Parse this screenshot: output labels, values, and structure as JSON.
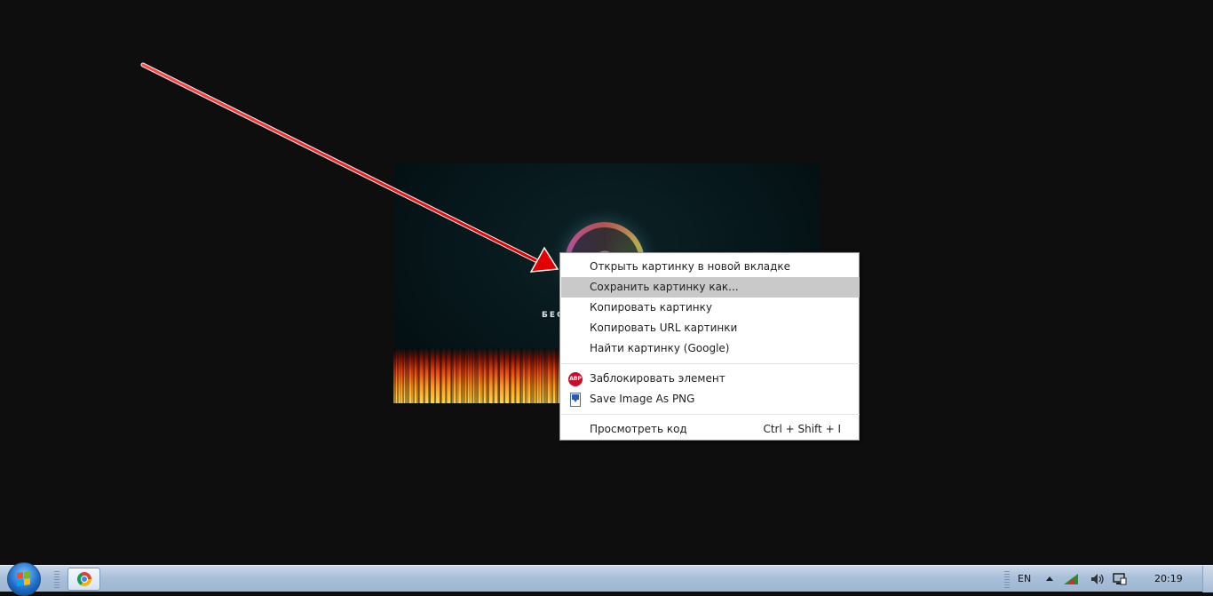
{
  "image": {
    "banner_text": "БЕС"
  },
  "context_menu": {
    "items": [
      {
        "label": "Открыть картинку в новой вкладке"
      },
      {
        "label": "Сохранить картинку как...",
        "highlighted": true
      },
      {
        "label": "Копировать картинку"
      },
      {
        "label": "Копировать URL картинки"
      },
      {
        "label": "Найти картинку (Google)"
      },
      {
        "label": "Заблокировать элемент",
        "icon": "adblock-plus-icon",
        "icon_text": "ABP"
      },
      {
        "label": "Save Image As PNG",
        "icon": "save-png-icon"
      },
      {
        "label": "Просмотреть код",
        "shortcut": "Ctrl + Shift + I"
      }
    ]
  },
  "taskbar": {
    "start_icon": "windows-start-orb-icon",
    "pinned_app_icon": "chrome-icon",
    "language": "EN",
    "clock": "20:19"
  },
  "annotation": {
    "arrow_color": "#ff1a1a"
  }
}
